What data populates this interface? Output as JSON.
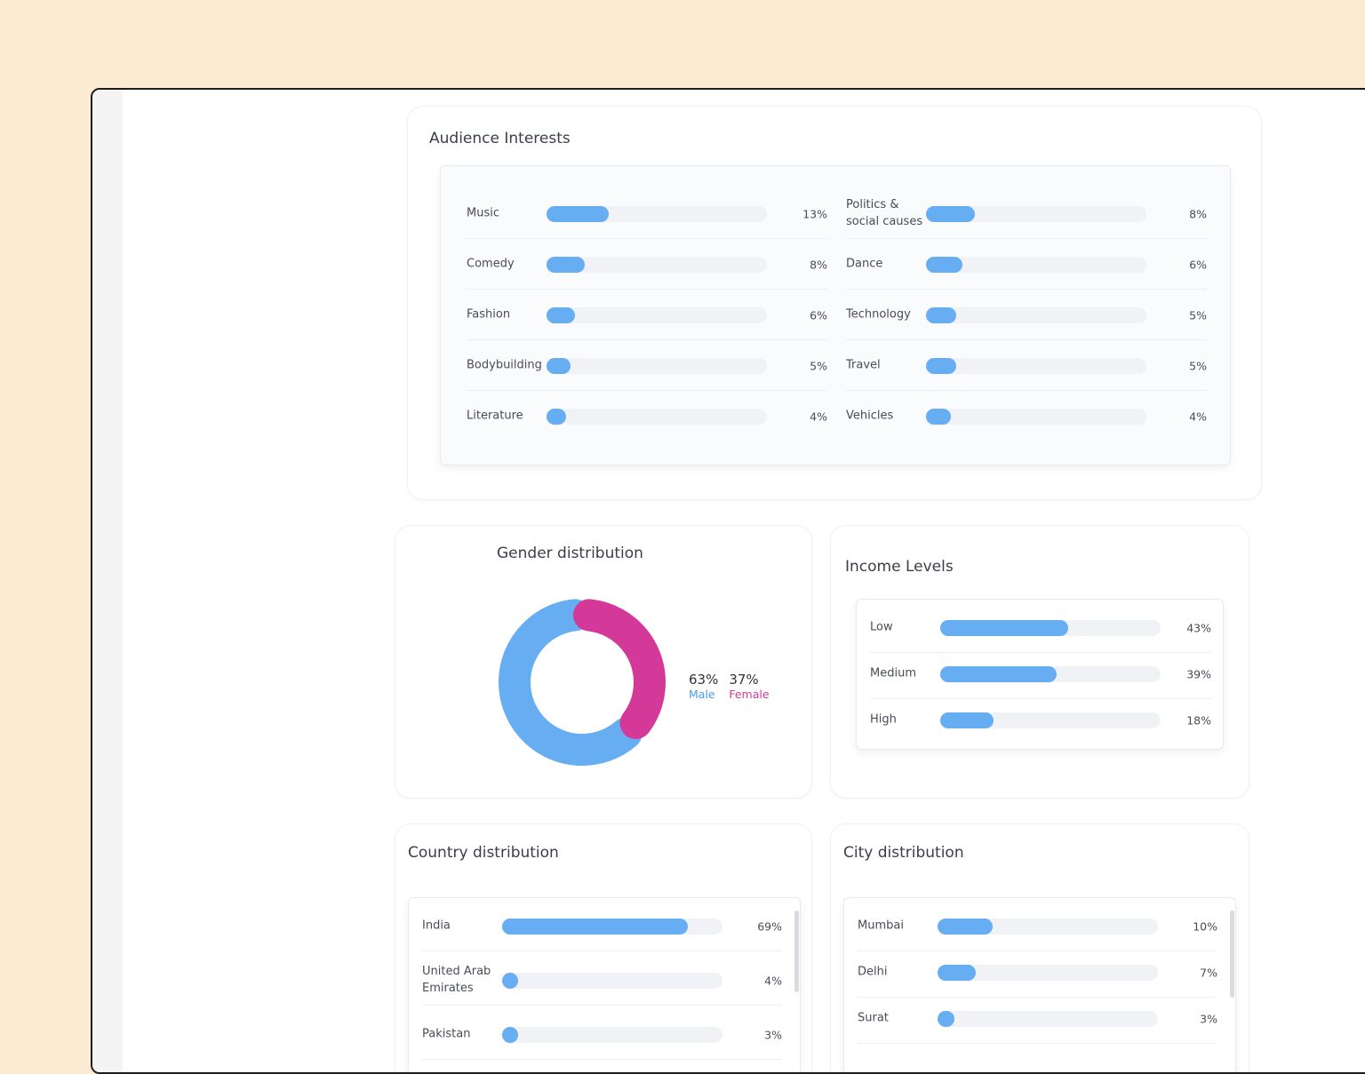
{
  "audience_interests": {
    "title": "Audience Interests",
    "left": [
      {
        "label": "Music",
        "value": 13,
        "pct": "13%"
      },
      {
        "label": "Comedy",
        "value": 8,
        "pct": "8%"
      },
      {
        "label": "Fashion",
        "value": 6,
        "pct": "6%"
      },
      {
        "label": "Bodybuilding",
        "value": 5,
        "pct": "5%"
      },
      {
        "label": "Literature",
        "value": 4,
        "pct": "4%"
      }
    ],
    "right": [
      {
        "label": "Politics & social causes",
        "value": 8,
        "pct": "8%"
      },
      {
        "label": "Dance",
        "value": 6,
        "pct": "6%"
      },
      {
        "label": "Technology",
        "value": 5,
        "pct": "5%"
      },
      {
        "label": "Travel",
        "value": 5,
        "pct": "5%"
      },
      {
        "label": "Vehicles",
        "value": 4,
        "pct": "4%"
      }
    ]
  },
  "gender": {
    "title": "Gender distribution",
    "male": {
      "pct": "63%",
      "label": "Male",
      "value": 63
    },
    "female": {
      "pct": "37%",
      "label": "Female",
      "value": 37
    },
    "colors": {
      "male": "#67adf2",
      "female": "#d4399a"
    }
  },
  "income": {
    "title": "Income Levels",
    "rows": [
      {
        "label": "Low",
        "value": 43,
        "pct": "43%"
      },
      {
        "label": "Medium",
        "value": 39,
        "pct": "39%"
      },
      {
        "label": "High",
        "value": 18,
        "pct": "18%"
      }
    ]
  },
  "country": {
    "title": "Country distribution",
    "rows": [
      {
        "label": "India",
        "value": 69,
        "pct": "69%"
      },
      {
        "label": "United Arab Emirates",
        "value": 4,
        "pct": "4%"
      },
      {
        "label": "Pakistan",
        "value": 3,
        "pct": "3%"
      }
    ]
  },
  "city": {
    "title": "City distribution",
    "rows": [
      {
        "label": "Mumbai",
        "value": 10,
        "pct": "10%"
      },
      {
        "label": "Delhi",
        "value": 7,
        "pct": "7%"
      },
      {
        "label": "Surat",
        "value": 3,
        "pct": "3%"
      }
    ]
  },
  "colors": {
    "bar": "#67adf2",
    "track": "#f0f2f5",
    "background": "#fcebd3"
  }
}
